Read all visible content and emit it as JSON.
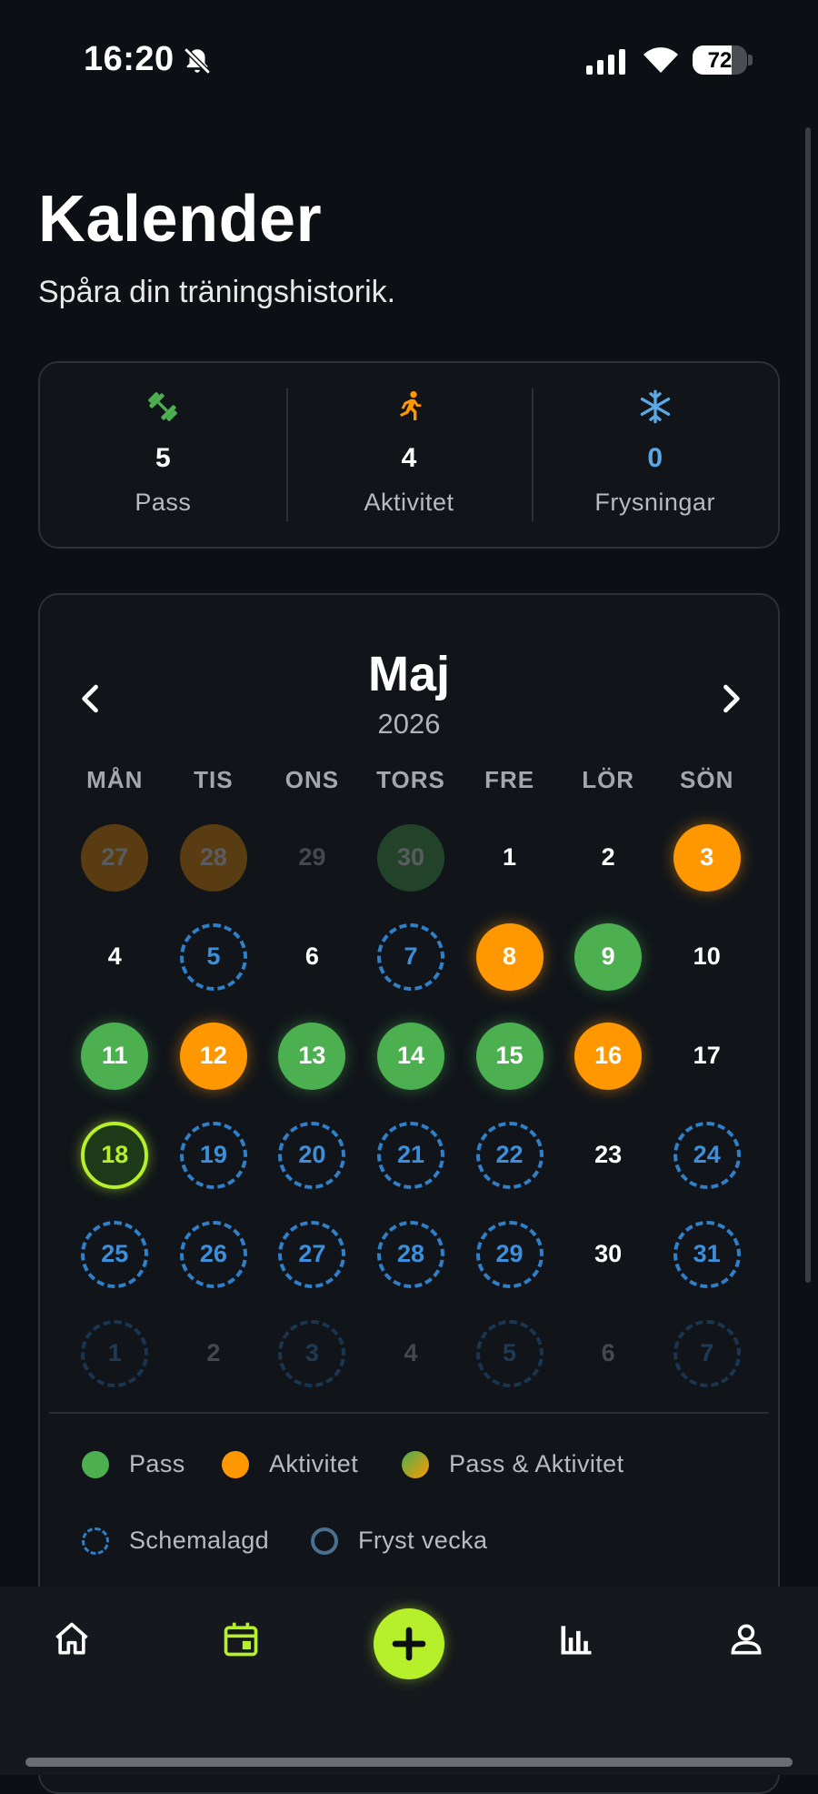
{
  "status_bar": {
    "time": "16:20",
    "battery": "72",
    "battery_level": 0.72
  },
  "header": {
    "title": "Kalender",
    "subtitle": "Spåra din träningshistorik."
  },
  "summary": [
    {
      "icon": "dumbbell-icon",
      "value": "5",
      "label": "Pass",
      "color": "#4caf50"
    },
    {
      "icon": "running-icon",
      "value": "4",
      "label": "Aktivitet",
      "color": "#ff9800"
    },
    {
      "icon": "snowflake-icon",
      "value": "0",
      "label": "Frysningar",
      "color": "#5aa9e6"
    }
  ],
  "calendar": {
    "month": "Maj",
    "year": "2026",
    "weekdays": [
      "MÅN",
      "TIS",
      "ONS",
      "TORS",
      "FRE",
      "LÖR",
      "SÖN"
    ],
    "days": [
      {
        "d": "27",
        "type": "orange",
        "outside": true
      },
      {
        "d": "28",
        "type": "orange",
        "outside": true
      },
      {
        "d": "29",
        "type": "none",
        "outside": true
      },
      {
        "d": "30",
        "type": "green",
        "outside": true
      },
      {
        "d": "1",
        "type": "none"
      },
      {
        "d": "2",
        "type": "none"
      },
      {
        "d": "3",
        "type": "orange"
      },
      {
        "d": "4",
        "type": "none"
      },
      {
        "d": "5",
        "type": "sched"
      },
      {
        "d": "6",
        "type": "none"
      },
      {
        "d": "7",
        "type": "sched"
      },
      {
        "d": "8",
        "type": "orange"
      },
      {
        "d": "9",
        "type": "green"
      },
      {
        "d": "10",
        "type": "none"
      },
      {
        "d": "11",
        "type": "green"
      },
      {
        "d": "12",
        "type": "orange"
      },
      {
        "d": "13",
        "type": "green"
      },
      {
        "d": "14",
        "type": "green"
      },
      {
        "d": "15",
        "type": "green"
      },
      {
        "d": "16",
        "type": "orange"
      },
      {
        "d": "17",
        "type": "none"
      },
      {
        "d": "18",
        "type": "today"
      },
      {
        "d": "19",
        "type": "sched"
      },
      {
        "d": "20",
        "type": "sched"
      },
      {
        "d": "21",
        "type": "sched"
      },
      {
        "d": "22",
        "type": "sched"
      },
      {
        "d": "23",
        "type": "none"
      },
      {
        "d": "24",
        "type": "sched"
      },
      {
        "d": "25",
        "type": "sched"
      },
      {
        "d": "26",
        "type": "sched"
      },
      {
        "d": "27",
        "type": "sched"
      },
      {
        "d": "28",
        "type": "sched"
      },
      {
        "d": "29",
        "type": "sched"
      },
      {
        "d": "30",
        "type": "none"
      },
      {
        "d": "31",
        "type": "sched"
      },
      {
        "d": "1",
        "type": "sched",
        "outside": true
      },
      {
        "d": "2",
        "type": "none",
        "outside": true
      },
      {
        "d": "3",
        "type": "sched",
        "outside": true
      },
      {
        "d": "4",
        "type": "none",
        "outside": true
      },
      {
        "d": "5",
        "type": "sched",
        "outside": true
      },
      {
        "d": "6",
        "type": "none",
        "outside": true
      },
      {
        "d": "7",
        "type": "sched",
        "outside": true
      }
    ]
  },
  "legend": {
    "pass": "Pass",
    "activity": "Aktivitet",
    "both": "Pass & Aktivitet",
    "scheduled": "Schemalagd",
    "frozen": "Fryst vecka"
  },
  "nav": {
    "items": [
      "home-icon",
      "calendar-icon",
      "add-icon",
      "stats-icon",
      "profile-icon"
    ],
    "active": "calendar-icon",
    "accent": "#b6f02a"
  }
}
